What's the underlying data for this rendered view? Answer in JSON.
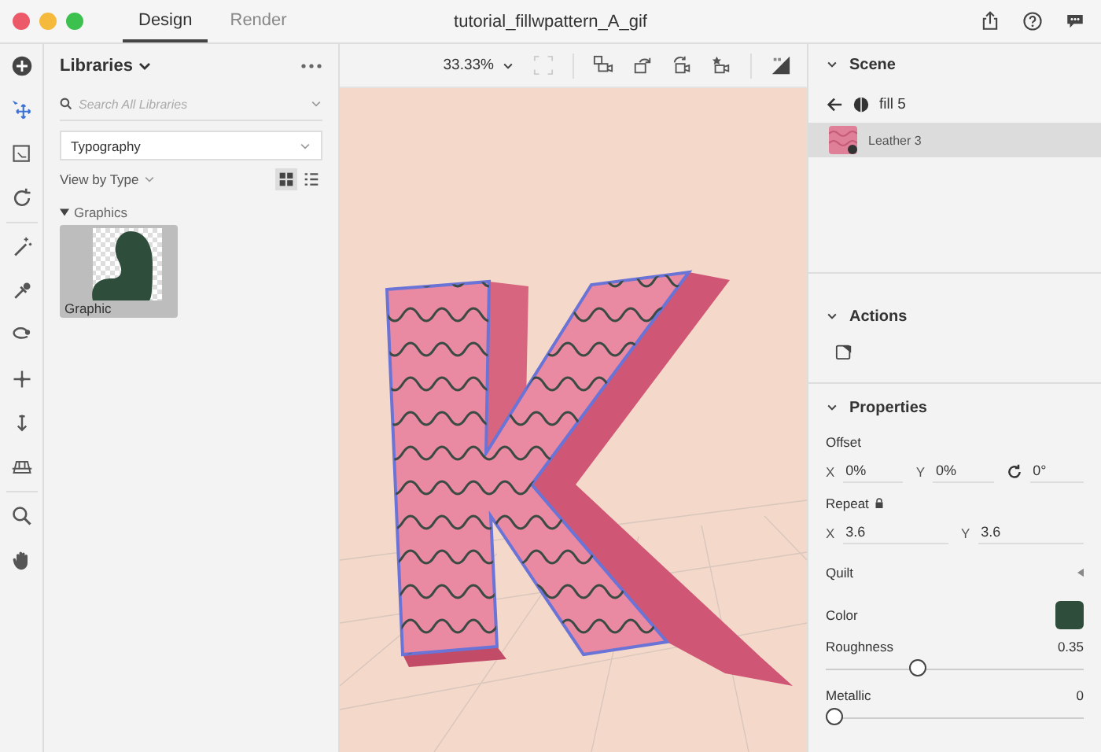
{
  "tabs": [
    {
      "label": "Design",
      "selected": true
    },
    {
      "label": "Render",
      "selected": false
    }
  ],
  "document_title": "tutorial_fillwpattern_A_gif",
  "libraries": {
    "title": "Libraries",
    "search": {
      "placeholder": "Search All Libraries"
    },
    "library_select": {
      "value": "Typography"
    },
    "view_by": "View by Type",
    "view_modes": [
      {
        "kind": "grid",
        "selected": true
      },
      {
        "kind": "list",
        "selected": false
      }
    ],
    "groups": [
      {
        "label": "Graphics",
        "expanded": true,
        "assets": [
          {
            "label": "Graphic"
          }
        ]
      }
    ]
  },
  "canvas_toolbar": {
    "zoom": "33.33%"
  },
  "scene": {
    "title": "Scene",
    "expanded": true,
    "path": "fill 5",
    "items": [
      {
        "label": "Leather 3",
        "selected": true
      }
    ]
  },
  "actions": {
    "title": "Actions",
    "expanded": true
  },
  "properties": {
    "title": "Properties",
    "expanded": true,
    "groups": [
      {
        "label": "Offset",
        "locked": false,
        "fields": [
          {
            "kind": "axis",
            "label": "X",
            "value": "0%"
          },
          {
            "kind": "axis",
            "label": "Y",
            "value": "0%"
          },
          {
            "kind": "rotation",
            "value": "0°"
          }
        ]
      },
      {
        "label": "Repeat",
        "locked": true,
        "fields": [
          {
            "kind": "axis",
            "label": "X",
            "value": "3.6"
          },
          {
            "kind": "axis",
            "label": "Y",
            "value": "3.6"
          }
        ]
      }
    ],
    "quilt": {
      "label": "Quilt",
      "expanded": false
    },
    "color": {
      "label": "Color",
      "color": "#2f4d3b"
    },
    "sliders": [
      {
        "label": "Roughness",
        "reading": "0.35",
        "level": 0.35
      },
      {
        "label": "Metallic",
        "reading": "0",
        "level": 0
      }
    ]
  }
}
